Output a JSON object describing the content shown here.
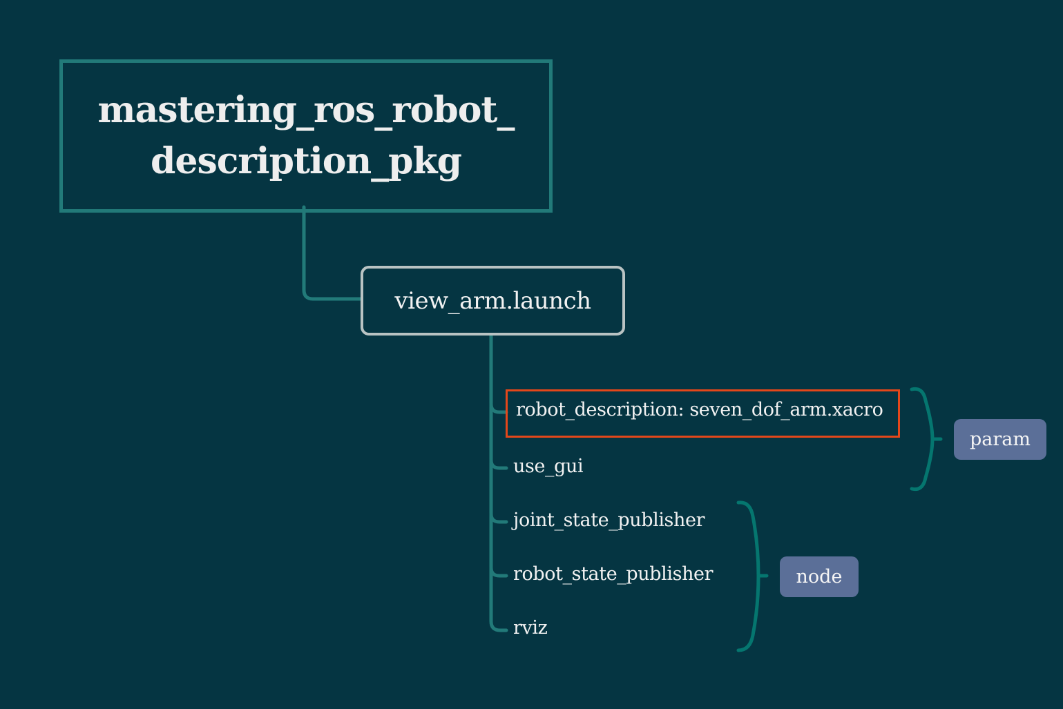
{
  "diagram": {
    "root": {
      "line1": "mastering_ros_robot_",
      "line2": "description_pkg"
    },
    "launch": {
      "label": "view_arm.launch"
    },
    "children": [
      "robot_description: seven_dof_arm.xacro",
      "use_gui",
      "joint_state_publisher",
      "robot_state_publisher",
      "rviz"
    ],
    "groups": {
      "param": "param",
      "node": "node"
    }
  },
  "colors": {
    "background": "#053542",
    "connector": "#227a79",
    "brace": "#05766f",
    "launch_border": "#b9c3c3",
    "highlight_border": "#e4471a",
    "tag_background": "#5b6f98"
  }
}
